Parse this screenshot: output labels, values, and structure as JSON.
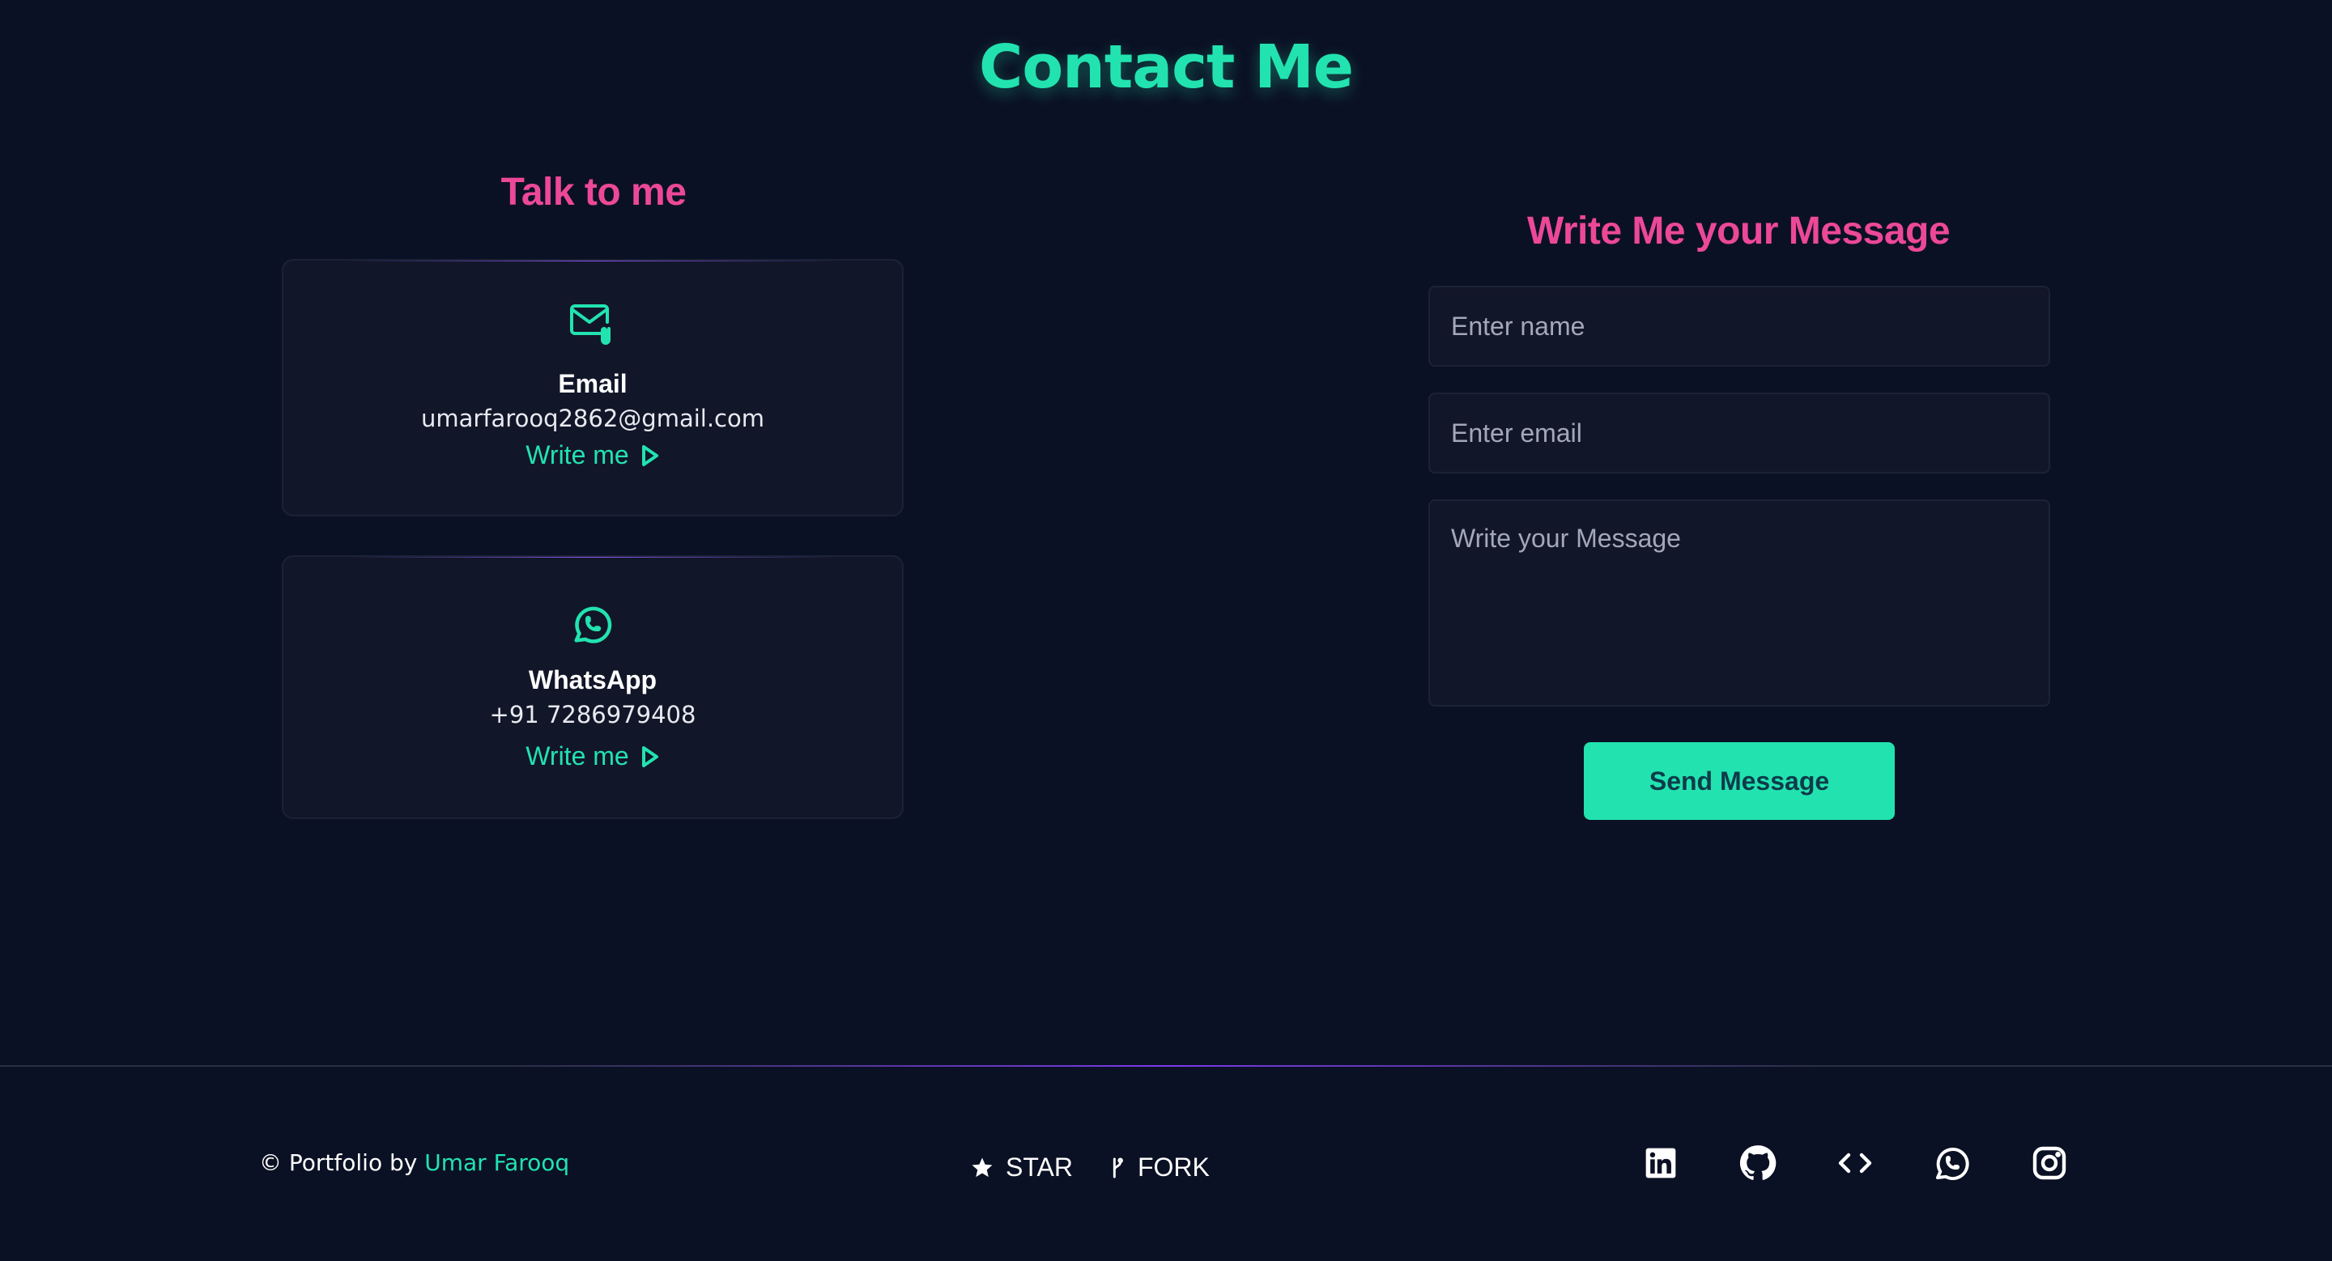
{
  "page": {
    "title": "Contact Me"
  },
  "talk": {
    "heading": "Talk to me",
    "cards": [
      {
        "icon": "mail-icon",
        "title": "Email",
        "value": "umarfarooq2862@gmail.com",
        "link_label": "Write me",
        "link_icon": "play-arrow-icon"
      },
      {
        "icon": "whatsapp-icon",
        "title": "WhatsApp",
        "value": "+91 7286979408",
        "link_label": "Write me",
        "link_icon": "play-arrow-icon"
      }
    ]
  },
  "form": {
    "heading": "Write Me your Message",
    "name_placeholder": "Enter name",
    "email_placeholder": "Enter email",
    "message_placeholder": "Write your Message",
    "submit_label": "Send Message"
  },
  "footer": {
    "credit_prefix": "© Portfolio by ",
    "credit_name": "Umar Farooq",
    "repo_actions": [
      {
        "icon": "star-icon",
        "label": "STAR"
      },
      {
        "icon": "fork-icon",
        "label": "FORK"
      }
    ],
    "social_icons": [
      "linkedin-icon",
      "github-icon",
      "code-icon",
      "whatsapp-icon",
      "instagram-icon"
    ]
  },
  "colors": {
    "background": "#0b1124",
    "accent": "#22e3b0",
    "heading_pink": "#ec4899",
    "card_bg": "#121629",
    "divider_glow": "#8b5cf6"
  }
}
